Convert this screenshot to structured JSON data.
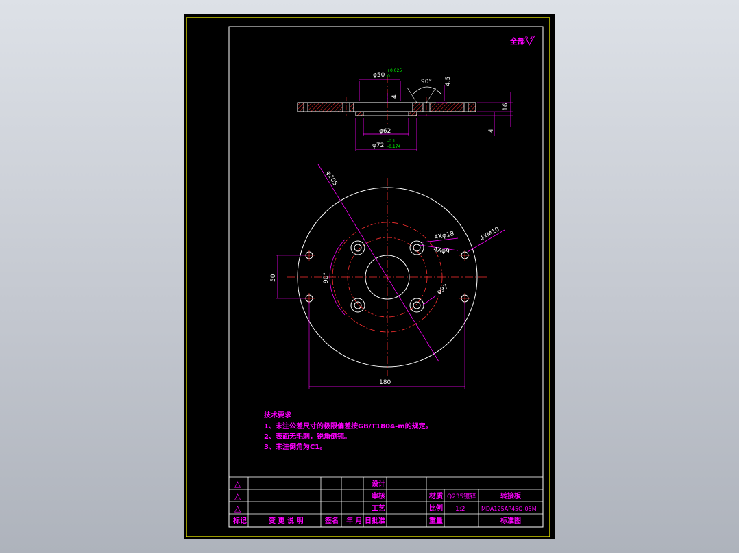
{
  "corner_mark": "全部",
  "corner_roughness": "6.3",
  "dims": {
    "d50": "φ50",
    "d50_tol_upper": "+0.025",
    "d50_tol_lower": "0",
    "angle_top": "90°",
    "h45": "4.5",
    "h4_inner": "4",
    "h16": "16",
    "h4_bottom": "4",
    "d62": "φ62",
    "d72": "φ72",
    "d72_tol_upper": "-0.1",
    "d72_tol_lower": "-0.174",
    "d205": "φ205",
    "hole18": "4Xφ18",
    "hole9": "4Xφ9",
    "m10": "4XM10",
    "d97": "φ97",
    "angle_plan": "90°",
    "v50": "50",
    "h180": "180"
  },
  "notes": {
    "title": "技术要求",
    "lines": [
      "1、未注公差尺寸的极限偏差按GB/T1804-m的规定。",
      "2、表面无毛刺，锐角倒钝。",
      "3、未注倒角为C1。"
    ]
  },
  "title_block": {
    "rev_symbol": "△",
    "design_label": "设计",
    "review_label": "审核",
    "process_label": "工艺",
    "approve_label": "批准",
    "mark_label": "标记",
    "change_label": "变 更 说 明",
    "sign_label": "签名",
    "date_label": "年 月 日",
    "material_label": "材质",
    "material_value": "Q235镀锌",
    "scale_label": "比例",
    "scale_value": "1:2",
    "weight_label": "重量",
    "part_name": "转接板",
    "drawing_no": "MDA125AP45Q-05M",
    "standard_label": "标准图"
  }
}
